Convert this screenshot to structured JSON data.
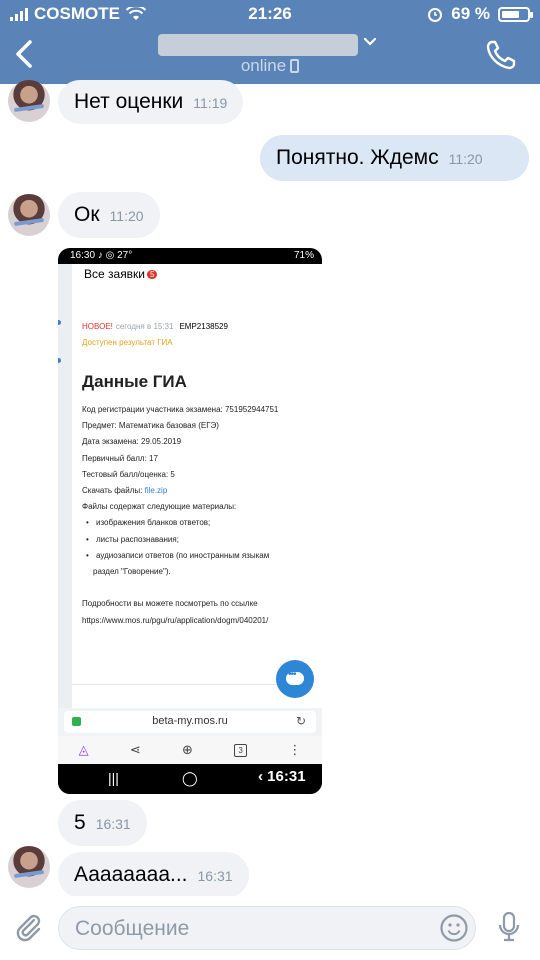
{
  "status_bar": {
    "carrier": "COSMOTE",
    "time": "21:26",
    "battery": "69 %",
    "battery_level": 0.69
  },
  "header": {
    "status": "online"
  },
  "messages": [
    {
      "text": "Нет оценки",
      "time": "11:19"
    },
    {
      "text": "Понятно. Ждемс",
      "time": "11:20"
    },
    {
      "text": "Ок",
      "time": "11:20"
    },
    {
      "text": "5",
      "time": "16:31"
    },
    {
      "text": "Аааааааа...",
      "time": "16:31"
    }
  ],
  "screenshot": {
    "status_time": "16:30",
    "status_icons": "♪ ◎ 27°",
    "status_right": "71%",
    "page_title": "Все заявки",
    "page_count": "5",
    "new_label": "НОВОЕ!",
    "when": "сегодня в 15:31",
    "app_id": "EMP2138529",
    "available": "Доступен результат ГИА",
    "heading": "Данные ГИА",
    "lines": {
      "reg": "Код регистрации участника экзамена: 751952944751",
      "subject": "Предмет: Математика базовая (ЕГЭ)",
      "date": "Дата экзамена: 29.05.2019",
      "primary": "Первичный балл: 17",
      "test": "Тестовый балл/оценка: 5",
      "download_label": "Скачать файлы: ",
      "download_link": "file.zip",
      "contains": "Файлы содержат следующие материалы:",
      "b1": "изображения бланков ответов;",
      "b2": "листы распознавания;",
      "b3": "аудиозаписи ответов (по иностранным языкам",
      "b3b": "раздел \"Говорение\").",
      "more": "Подробности вы можете посмотреть по ссылке",
      "url_long": "https://www.mos.ru/pgu/ru/application/dogm/040201/"
    },
    "url": "beta-my.mos.ru",
    "tabs_count": "3",
    "nav_time": "16:31"
  },
  "input": {
    "placeholder": "Сообщение"
  }
}
